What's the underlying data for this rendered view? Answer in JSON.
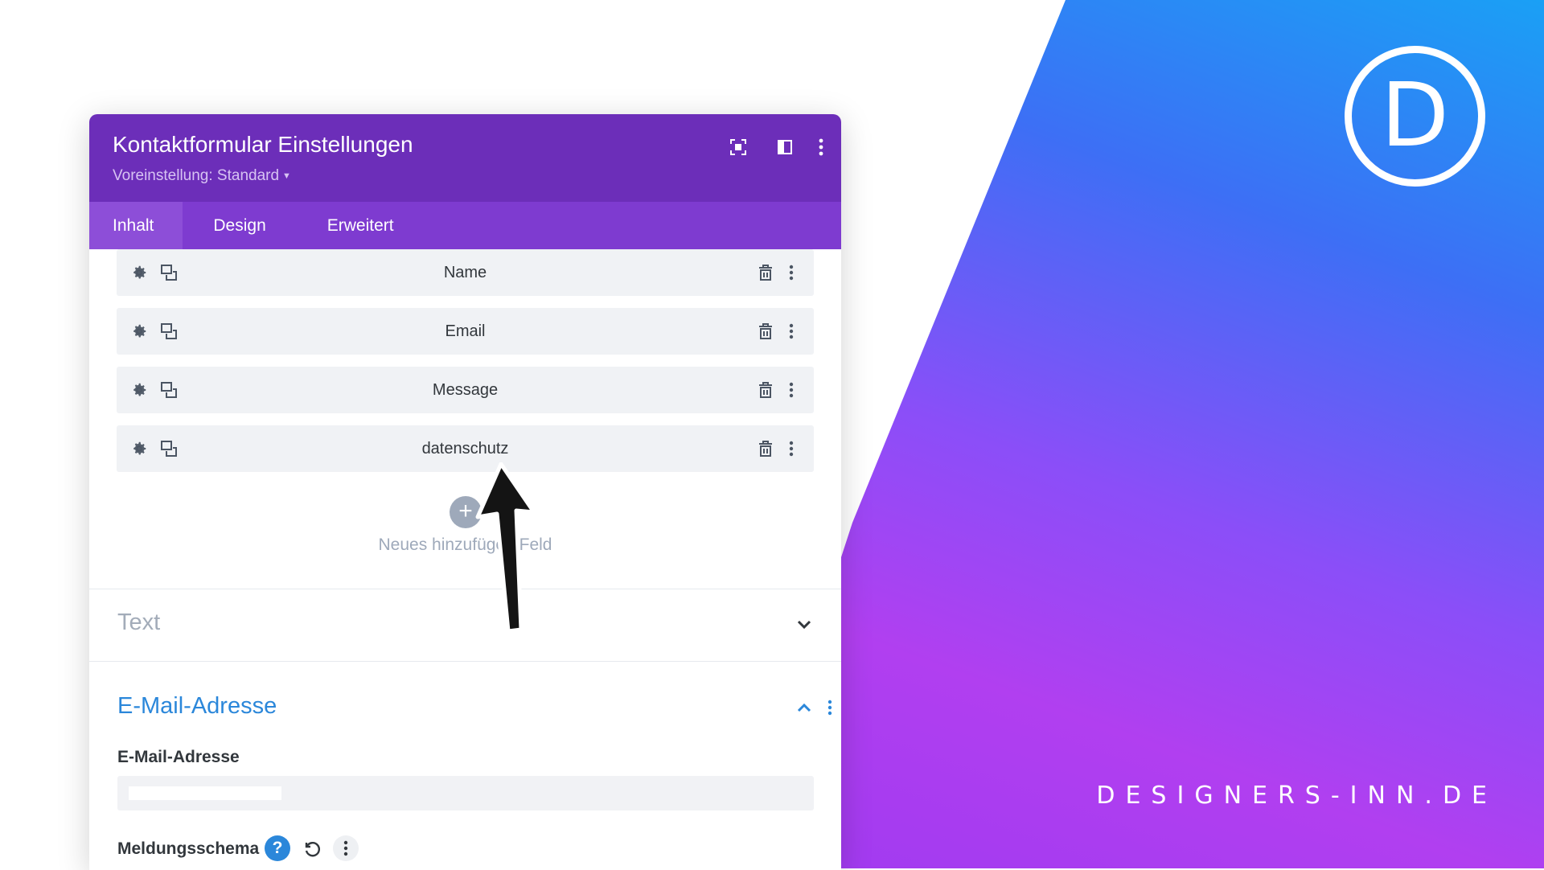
{
  "modal": {
    "title": "Kontaktformular Einstellungen",
    "preset": "Voreinstellung: Standard",
    "tabs": [
      {
        "label": "Inhalt",
        "active": true
      },
      {
        "label": "Design",
        "active": false
      },
      {
        "label": "Erweitert",
        "active": false
      }
    ],
    "fields": [
      {
        "label": "Name"
      },
      {
        "label": "Email"
      },
      {
        "label": "Message"
      },
      {
        "label": "datenschutz"
      }
    ],
    "add_field_label": "Neues hinzufügen Feld",
    "sections": {
      "text_title": "Text",
      "email_title": "E-Mail-Adresse"
    },
    "email_field_label": "E-Mail-Adresse",
    "email_value": "",
    "message_pattern_label": "Meldungsschema",
    "help_symbol": "?"
  },
  "branding": {
    "logo_letter": "D",
    "site": "DESIGNERS-INN.DE"
  },
  "colors": {
    "header": "#6c2eb9",
    "tabs": "#7e3bd0",
    "accent_blue": "#2b87da"
  },
  "icons": [
    "screenshot-icon",
    "sidebar-icon",
    "kebab-icon",
    "gear-icon",
    "duplicate-icon",
    "trash-icon",
    "chevron-down-icon",
    "chevron-up-icon",
    "reset-icon",
    "help-icon",
    "plus-icon",
    "arrow-annotation"
  ]
}
